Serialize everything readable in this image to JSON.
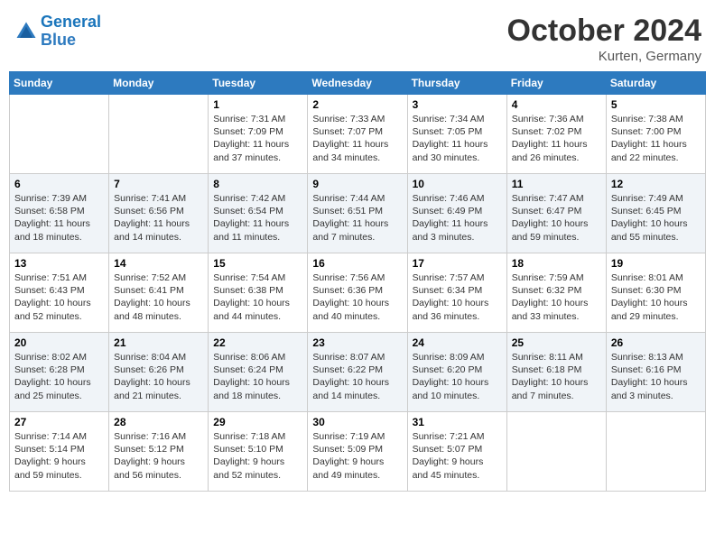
{
  "header": {
    "logo_general": "General",
    "logo_blue": "Blue",
    "month": "October 2024",
    "location": "Kurten, Germany"
  },
  "days_of_week": [
    "Sunday",
    "Monday",
    "Tuesday",
    "Wednesday",
    "Thursday",
    "Friday",
    "Saturday"
  ],
  "weeks": [
    [
      {
        "day": "",
        "sunrise": "",
        "sunset": "",
        "daylight": ""
      },
      {
        "day": "",
        "sunrise": "",
        "sunset": "",
        "daylight": ""
      },
      {
        "day": "1",
        "sunrise": "Sunrise: 7:31 AM",
        "sunset": "Sunset: 7:09 PM",
        "daylight": "Daylight: 11 hours and 37 minutes."
      },
      {
        "day": "2",
        "sunrise": "Sunrise: 7:33 AM",
        "sunset": "Sunset: 7:07 PM",
        "daylight": "Daylight: 11 hours and 34 minutes."
      },
      {
        "day": "3",
        "sunrise": "Sunrise: 7:34 AM",
        "sunset": "Sunset: 7:05 PM",
        "daylight": "Daylight: 11 hours and 30 minutes."
      },
      {
        "day": "4",
        "sunrise": "Sunrise: 7:36 AM",
        "sunset": "Sunset: 7:02 PM",
        "daylight": "Daylight: 11 hours and 26 minutes."
      },
      {
        "day": "5",
        "sunrise": "Sunrise: 7:38 AM",
        "sunset": "Sunset: 7:00 PM",
        "daylight": "Daylight: 11 hours and 22 minutes."
      }
    ],
    [
      {
        "day": "6",
        "sunrise": "Sunrise: 7:39 AM",
        "sunset": "Sunset: 6:58 PM",
        "daylight": "Daylight: 11 hours and 18 minutes."
      },
      {
        "day": "7",
        "sunrise": "Sunrise: 7:41 AM",
        "sunset": "Sunset: 6:56 PM",
        "daylight": "Daylight: 11 hours and 14 minutes."
      },
      {
        "day": "8",
        "sunrise": "Sunrise: 7:42 AM",
        "sunset": "Sunset: 6:54 PM",
        "daylight": "Daylight: 11 hours and 11 minutes."
      },
      {
        "day": "9",
        "sunrise": "Sunrise: 7:44 AM",
        "sunset": "Sunset: 6:51 PM",
        "daylight": "Daylight: 11 hours and 7 minutes."
      },
      {
        "day": "10",
        "sunrise": "Sunrise: 7:46 AM",
        "sunset": "Sunset: 6:49 PM",
        "daylight": "Daylight: 11 hours and 3 minutes."
      },
      {
        "day": "11",
        "sunrise": "Sunrise: 7:47 AM",
        "sunset": "Sunset: 6:47 PM",
        "daylight": "Daylight: 10 hours and 59 minutes."
      },
      {
        "day": "12",
        "sunrise": "Sunrise: 7:49 AM",
        "sunset": "Sunset: 6:45 PM",
        "daylight": "Daylight: 10 hours and 55 minutes."
      }
    ],
    [
      {
        "day": "13",
        "sunrise": "Sunrise: 7:51 AM",
        "sunset": "Sunset: 6:43 PM",
        "daylight": "Daylight: 10 hours and 52 minutes."
      },
      {
        "day": "14",
        "sunrise": "Sunrise: 7:52 AM",
        "sunset": "Sunset: 6:41 PM",
        "daylight": "Daylight: 10 hours and 48 minutes."
      },
      {
        "day": "15",
        "sunrise": "Sunrise: 7:54 AM",
        "sunset": "Sunset: 6:38 PM",
        "daylight": "Daylight: 10 hours and 44 minutes."
      },
      {
        "day": "16",
        "sunrise": "Sunrise: 7:56 AM",
        "sunset": "Sunset: 6:36 PM",
        "daylight": "Daylight: 10 hours and 40 minutes."
      },
      {
        "day": "17",
        "sunrise": "Sunrise: 7:57 AM",
        "sunset": "Sunset: 6:34 PM",
        "daylight": "Daylight: 10 hours and 36 minutes."
      },
      {
        "day": "18",
        "sunrise": "Sunrise: 7:59 AM",
        "sunset": "Sunset: 6:32 PM",
        "daylight": "Daylight: 10 hours and 33 minutes."
      },
      {
        "day": "19",
        "sunrise": "Sunrise: 8:01 AM",
        "sunset": "Sunset: 6:30 PM",
        "daylight": "Daylight: 10 hours and 29 minutes."
      }
    ],
    [
      {
        "day": "20",
        "sunrise": "Sunrise: 8:02 AM",
        "sunset": "Sunset: 6:28 PM",
        "daylight": "Daylight: 10 hours and 25 minutes."
      },
      {
        "day": "21",
        "sunrise": "Sunrise: 8:04 AM",
        "sunset": "Sunset: 6:26 PM",
        "daylight": "Daylight: 10 hours and 21 minutes."
      },
      {
        "day": "22",
        "sunrise": "Sunrise: 8:06 AM",
        "sunset": "Sunset: 6:24 PM",
        "daylight": "Daylight: 10 hours and 18 minutes."
      },
      {
        "day": "23",
        "sunrise": "Sunrise: 8:07 AM",
        "sunset": "Sunset: 6:22 PM",
        "daylight": "Daylight: 10 hours and 14 minutes."
      },
      {
        "day": "24",
        "sunrise": "Sunrise: 8:09 AM",
        "sunset": "Sunset: 6:20 PM",
        "daylight": "Daylight: 10 hours and 10 minutes."
      },
      {
        "day": "25",
        "sunrise": "Sunrise: 8:11 AM",
        "sunset": "Sunset: 6:18 PM",
        "daylight": "Daylight: 10 hours and 7 minutes."
      },
      {
        "day": "26",
        "sunrise": "Sunrise: 8:13 AM",
        "sunset": "Sunset: 6:16 PM",
        "daylight": "Daylight: 10 hours and 3 minutes."
      }
    ],
    [
      {
        "day": "27",
        "sunrise": "Sunrise: 7:14 AM",
        "sunset": "Sunset: 5:14 PM",
        "daylight": "Daylight: 9 hours and 59 minutes."
      },
      {
        "day": "28",
        "sunrise": "Sunrise: 7:16 AM",
        "sunset": "Sunset: 5:12 PM",
        "daylight": "Daylight: 9 hours and 56 minutes."
      },
      {
        "day": "29",
        "sunrise": "Sunrise: 7:18 AM",
        "sunset": "Sunset: 5:10 PM",
        "daylight": "Daylight: 9 hours and 52 minutes."
      },
      {
        "day": "30",
        "sunrise": "Sunrise: 7:19 AM",
        "sunset": "Sunset: 5:09 PM",
        "daylight": "Daylight: 9 hours and 49 minutes."
      },
      {
        "day": "31",
        "sunrise": "Sunrise: 7:21 AM",
        "sunset": "Sunset: 5:07 PM",
        "daylight": "Daylight: 9 hours and 45 minutes."
      },
      {
        "day": "",
        "sunrise": "",
        "sunset": "",
        "daylight": ""
      },
      {
        "day": "",
        "sunrise": "",
        "sunset": "",
        "daylight": ""
      }
    ]
  ]
}
